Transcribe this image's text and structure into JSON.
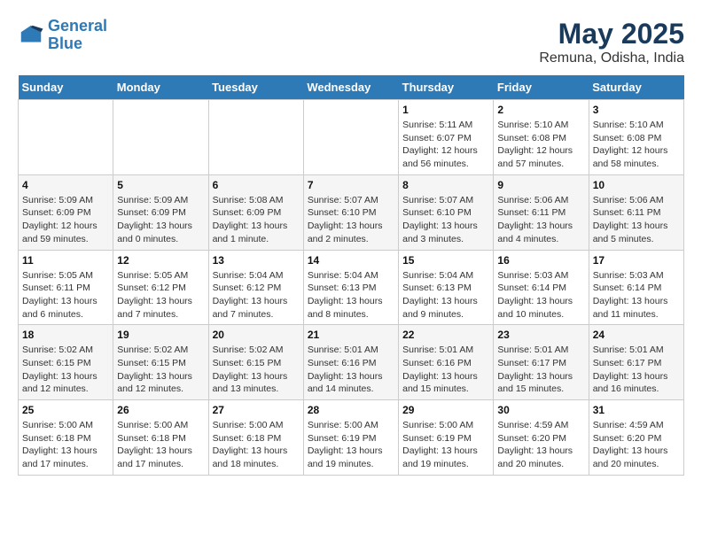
{
  "logo": {
    "line1": "General",
    "line2": "Blue"
  },
  "title": "May 2025",
  "subtitle": "Remuna, Odisha, India",
  "weekdays": [
    "Sunday",
    "Monday",
    "Tuesday",
    "Wednesday",
    "Thursday",
    "Friday",
    "Saturday"
  ],
  "weeks": [
    [
      {
        "day": "",
        "info": ""
      },
      {
        "day": "",
        "info": ""
      },
      {
        "day": "",
        "info": ""
      },
      {
        "day": "",
        "info": ""
      },
      {
        "day": "1",
        "info": "Sunrise: 5:11 AM\nSunset: 6:07 PM\nDaylight: 12 hours\nand 56 minutes."
      },
      {
        "day": "2",
        "info": "Sunrise: 5:10 AM\nSunset: 6:08 PM\nDaylight: 12 hours\nand 57 minutes."
      },
      {
        "day": "3",
        "info": "Sunrise: 5:10 AM\nSunset: 6:08 PM\nDaylight: 12 hours\nand 58 minutes."
      }
    ],
    [
      {
        "day": "4",
        "info": "Sunrise: 5:09 AM\nSunset: 6:09 PM\nDaylight: 12 hours\nand 59 minutes."
      },
      {
        "day": "5",
        "info": "Sunrise: 5:09 AM\nSunset: 6:09 PM\nDaylight: 13 hours\nand 0 minutes."
      },
      {
        "day": "6",
        "info": "Sunrise: 5:08 AM\nSunset: 6:09 PM\nDaylight: 13 hours\nand 1 minute."
      },
      {
        "day": "7",
        "info": "Sunrise: 5:07 AM\nSunset: 6:10 PM\nDaylight: 13 hours\nand 2 minutes."
      },
      {
        "day": "8",
        "info": "Sunrise: 5:07 AM\nSunset: 6:10 PM\nDaylight: 13 hours\nand 3 minutes."
      },
      {
        "day": "9",
        "info": "Sunrise: 5:06 AM\nSunset: 6:11 PM\nDaylight: 13 hours\nand 4 minutes."
      },
      {
        "day": "10",
        "info": "Sunrise: 5:06 AM\nSunset: 6:11 PM\nDaylight: 13 hours\nand 5 minutes."
      }
    ],
    [
      {
        "day": "11",
        "info": "Sunrise: 5:05 AM\nSunset: 6:11 PM\nDaylight: 13 hours\nand 6 minutes."
      },
      {
        "day": "12",
        "info": "Sunrise: 5:05 AM\nSunset: 6:12 PM\nDaylight: 13 hours\nand 7 minutes."
      },
      {
        "day": "13",
        "info": "Sunrise: 5:04 AM\nSunset: 6:12 PM\nDaylight: 13 hours\nand 7 minutes."
      },
      {
        "day": "14",
        "info": "Sunrise: 5:04 AM\nSunset: 6:13 PM\nDaylight: 13 hours\nand 8 minutes."
      },
      {
        "day": "15",
        "info": "Sunrise: 5:04 AM\nSunset: 6:13 PM\nDaylight: 13 hours\nand 9 minutes."
      },
      {
        "day": "16",
        "info": "Sunrise: 5:03 AM\nSunset: 6:14 PM\nDaylight: 13 hours\nand 10 minutes."
      },
      {
        "day": "17",
        "info": "Sunrise: 5:03 AM\nSunset: 6:14 PM\nDaylight: 13 hours\nand 11 minutes."
      }
    ],
    [
      {
        "day": "18",
        "info": "Sunrise: 5:02 AM\nSunset: 6:15 PM\nDaylight: 13 hours\nand 12 minutes."
      },
      {
        "day": "19",
        "info": "Sunrise: 5:02 AM\nSunset: 6:15 PM\nDaylight: 13 hours\nand 12 minutes."
      },
      {
        "day": "20",
        "info": "Sunrise: 5:02 AM\nSunset: 6:15 PM\nDaylight: 13 hours\nand 13 minutes."
      },
      {
        "day": "21",
        "info": "Sunrise: 5:01 AM\nSunset: 6:16 PM\nDaylight: 13 hours\nand 14 minutes."
      },
      {
        "day": "22",
        "info": "Sunrise: 5:01 AM\nSunset: 6:16 PM\nDaylight: 13 hours\nand 15 minutes."
      },
      {
        "day": "23",
        "info": "Sunrise: 5:01 AM\nSunset: 6:17 PM\nDaylight: 13 hours\nand 15 minutes."
      },
      {
        "day": "24",
        "info": "Sunrise: 5:01 AM\nSunset: 6:17 PM\nDaylight: 13 hours\nand 16 minutes."
      }
    ],
    [
      {
        "day": "25",
        "info": "Sunrise: 5:00 AM\nSunset: 6:18 PM\nDaylight: 13 hours\nand 17 minutes."
      },
      {
        "day": "26",
        "info": "Sunrise: 5:00 AM\nSunset: 6:18 PM\nDaylight: 13 hours\nand 17 minutes."
      },
      {
        "day": "27",
        "info": "Sunrise: 5:00 AM\nSunset: 6:18 PM\nDaylight: 13 hours\nand 18 minutes."
      },
      {
        "day": "28",
        "info": "Sunrise: 5:00 AM\nSunset: 6:19 PM\nDaylight: 13 hours\nand 19 minutes."
      },
      {
        "day": "29",
        "info": "Sunrise: 5:00 AM\nSunset: 6:19 PM\nDaylight: 13 hours\nand 19 minutes."
      },
      {
        "day": "30",
        "info": "Sunrise: 4:59 AM\nSunset: 6:20 PM\nDaylight: 13 hours\nand 20 minutes."
      },
      {
        "day": "31",
        "info": "Sunrise: 4:59 AM\nSunset: 6:20 PM\nDaylight: 13 hours\nand 20 minutes."
      }
    ]
  ]
}
